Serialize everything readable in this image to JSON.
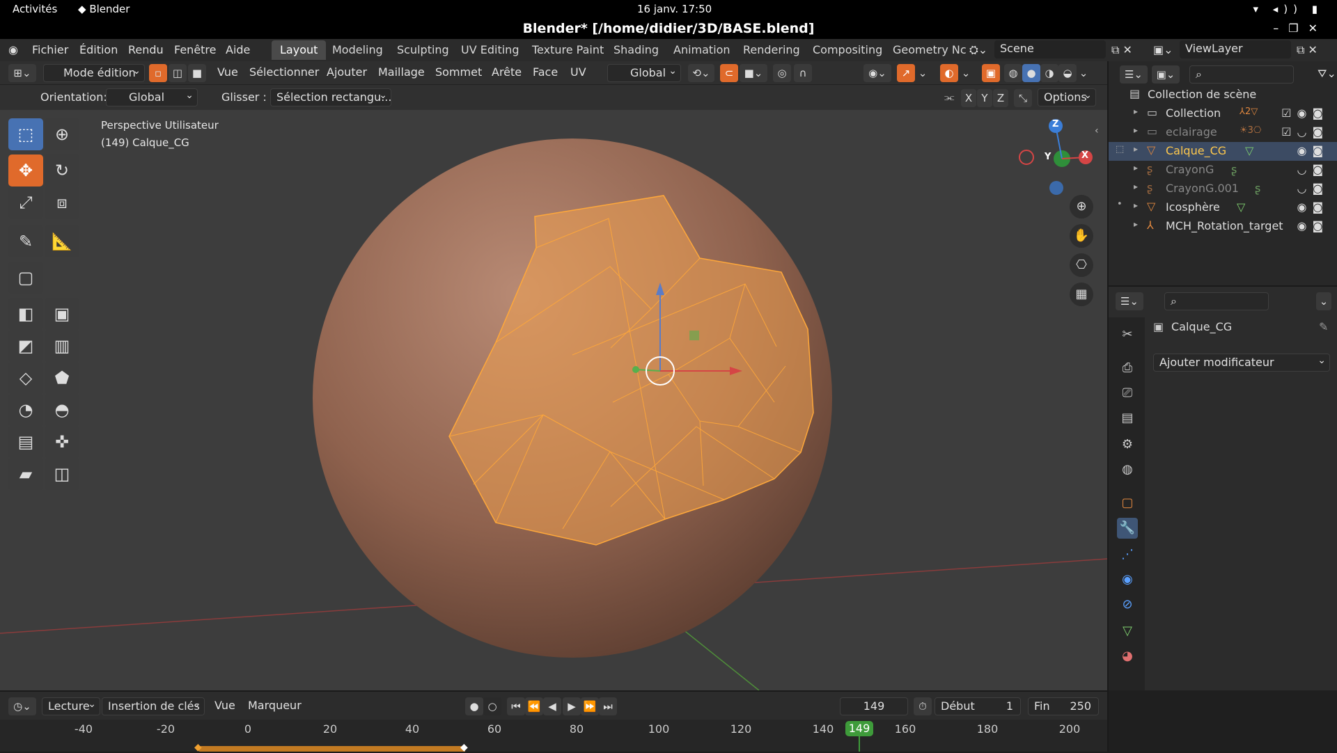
{
  "gnome": {
    "activities": "Activités",
    "app": "Blender",
    "clock": "16 janv.  17:50"
  },
  "window": {
    "title": "Blender* [/home/didier/3D/BASE.blend]"
  },
  "menu": {
    "items": [
      "Fichier",
      "Édition",
      "Rendu",
      "Fenêtre",
      "Aide"
    ]
  },
  "workspaces": {
    "tabs": [
      "Layout",
      "Modeling",
      "Sculpting",
      "UV Editing",
      "Texture Paint",
      "Shading",
      "Animation",
      "Rendering",
      "Compositing",
      "Geometry Nc"
    ],
    "active": "Layout"
  },
  "scene": {
    "name": "Scene",
    "viewlayer": "ViewLayer"
  },
  "toolheader": {
    "mode": "Mode édition",
    "menus": [
      "Vue",
      "Sélectionner",
      "Ajouter",
      "Maillage",
      "Sommet",
      "Arête",
      "Face",
      "UV"
    ],
    "transform": "Global"
  },
  "options": {
    "orientation_label": "Orientation:",
    "orientation_value": "Global",
    "drag_label": "Glisser :",
    "drag_value": "Sélection rectangu...",
    "axes": [
      "X",
      "Y",
      "Z"
    ],
    "options_label": "Options"
  },
  "viewport": {
    "view_name": "Perspective Utilisateur",
    "object_info": "(149) Calque_CG",
    "gizmo": {
      "z": "Z",
      "y": "Y",
      "x": "X"
    }
  },
  "outliner": {
    "root": "Collection de scène",
    "items": [
      {
        "name": "Collection",
        "icon": "collection",
        "badge": "2",
        "dim": false
      },
      {
        "name": "eclairage",
        "icon": "collection",
        "badge": "3",
        "dim": true
      },
      {
        "name": "Calque_CG",
        "icon": "mesh",
        "badge": "",
        "dim": false,
        "selected": true
      },
      {
        "name": "CrayonG",
        "icon": "gpencil",
        "badge": "",
        "dim": true
      },
      {
        "name": "CrayonG.001",
        "icon": "gpencil",
        "badge": "",
        "dim": true
      },
      {
        "name": "Icosphère",
        "icon": "mesh",
        "badge": "",
        "dim": false
      },
      {
        "name": "MCH_Rotation_target",
        "icon": "armature",
        "badge": "",
        "dim": false
      }
    ]
  },
  "properties": {
    "object": "Calque_CG",
    "add_modifier": "Ajouter modificateur"
  },
  "timeline": {
    "menus": [
      "Lecture",
      "Insertion de clés",
      "Vue",
      "Marqueur"
    ],
    "current": "149",
    "start_label": "Début",
    "start": "1",
    "end_label": "Fin",
    "end": "250",
    "ticks": [
      "-40",
      "-20",
      "0",
      "20",
      "40",
      "60",
      "80",
      "100",
      "120",
      "140",
      "149",
      "160",
      "180",
      "200"
    ]
  },
  "colors": {
    "accent": "#e06a2b",
    "select": "#4772b3",
    "mesh": "#f0a050"
  }
}
